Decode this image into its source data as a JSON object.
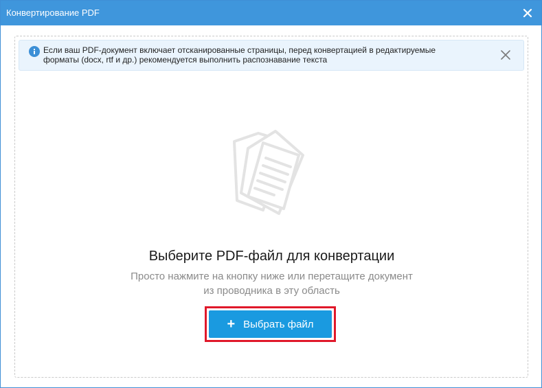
{
  "window": {
    "title": "Конвертирование PDF"
  },
  "notice": {
    "icon": "info-icon",
    "line1": "Если ваш PDF-документ включает отсканированные страницы, перед конвертацией в редактируемые",
    "line2": "форматы (docx, rtf и др.) рекомендуется выполнить распознавание текста"
  },
  "dropzone": {
    "illustration_icon": "documents-icon",
    "headline": "Выберите PDF-файл для конвертации",
    "subtext_line1": "Просто нажмите на кнопку ниже или перетащите документ",
    "subtext_line2": "из проводника в эту область",
    "button_label": "Выбрать файл",
    "button_icon": "+"
  },
  "colors": {
    "titlebar": "#3f96dc",
    "button": "#1a9ae0",
    "highlight": "#e0182a",
    "notice_bg": "#eaf4fd"
  }
}
